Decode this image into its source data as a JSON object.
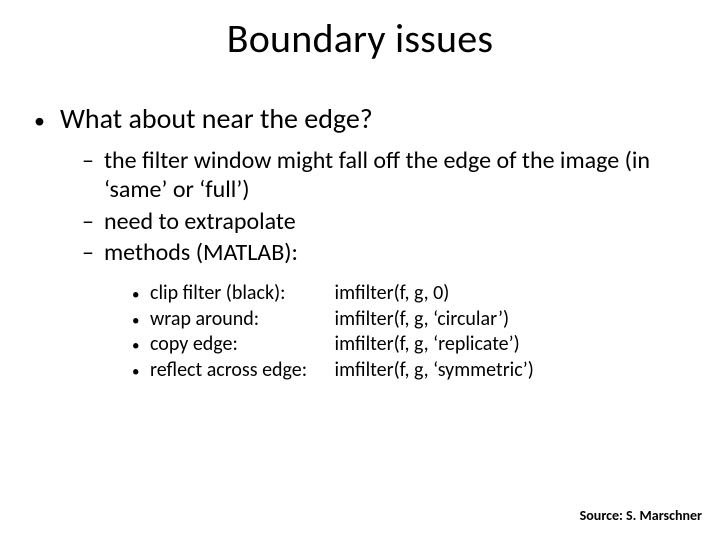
{
  "title": "Boundary issues",
  "question": "What about near the edge?",
  "subpoints": [
    "the filter window might fall off the edge of the image (in ‘same’ or ‘full’)",
    "need to extrapolate",
    "methods (MATLAB):"
  ],
  "methods": [
    {
      "label": "clip filter (black):",
      "code": "imfilter(f, g, 0)"
    },
    {
      "label": "wrap around:",
      "code": "imfilter(f, g, ‘circular’)"
    },
    {
      "label": "copy edge:",
      "code": "imfilter(f, g, ‘replicate’)"
    },
    {
      "label": "reflect across edge:",
      "code": "imfilter(f, g, ‘symmetric’)"
    }
  ],
  "source": "Source: S. Marschner"
}
